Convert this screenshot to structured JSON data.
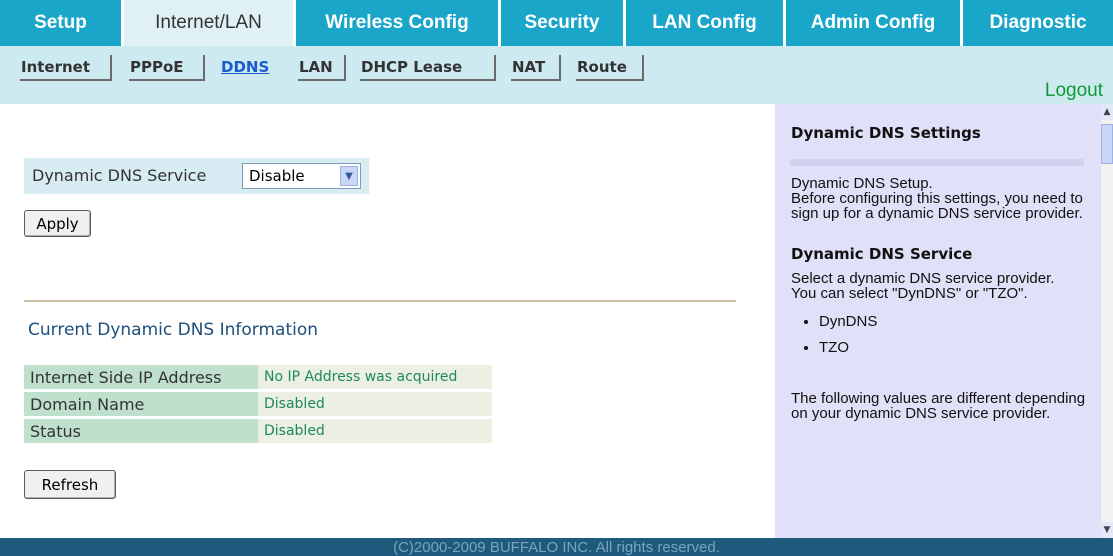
{
  "top_tabs": [
    "Setup",
    "Internet/LAN",
    "Wireless Config",
    "Security",
    "LAN Config",
    "Admin Config",
    "Diagnostic"
  ],
  "sub_tabs": [
    "Internet",
    "PPPoE",
    "DDNS",
    "LAN",
    "DHCP Lease",
    "NAT",
    "Route"
  ],
  "logout": "Logout",
  "main": {
    "ddns_service_label": "Dynamic DNS Service",
    "ddns_service_value": "Disable",
    "apply_label": "Apply",
    "info_title": "Current Dynamic DNS Information",
    "info_rows": [
      {
        "key": "Internet Side IP Address",
        "value": "No IP Address was acquired"
      },
      {
        "key": "Domain Name",
        "value": "Disabled"
      },
      {
        "key": "Status",
        "value": "Disabled"
      }
    ],
    "refresh_label": "Refresh"
  },
  "help": {
    "settings_title": "Dynamic DNS Settings",
    "setup_text_1": "Dynamic DNS Setup.",
    "setup_text_2": "Before configuring this settings, you need to sign up for a dynamic DNS service provider.",
    "service_title": "Dynamic DNS Service",
    "service_text_1": "Select a dynamic DNS service provider.",
    "service_text_2": "You can select \"DynDNS\" or \"TZO\".",
    "providers": [
      "DynDNS",
      "TZO"
    ],
    "following_text": "The following values are different depending on your dynamic DNS service provider."
  },
  "footer": "(C)2000-2009 BUFFALO INC. All rights reserved.",
  "colors": {
    "tab_bg": "#1aa6c8",
    "sub_bar": "#cdeaf1",
    "help_bg": "#e0e0f8",
    "footer_bg": "#1e5a7c"
  }
}
